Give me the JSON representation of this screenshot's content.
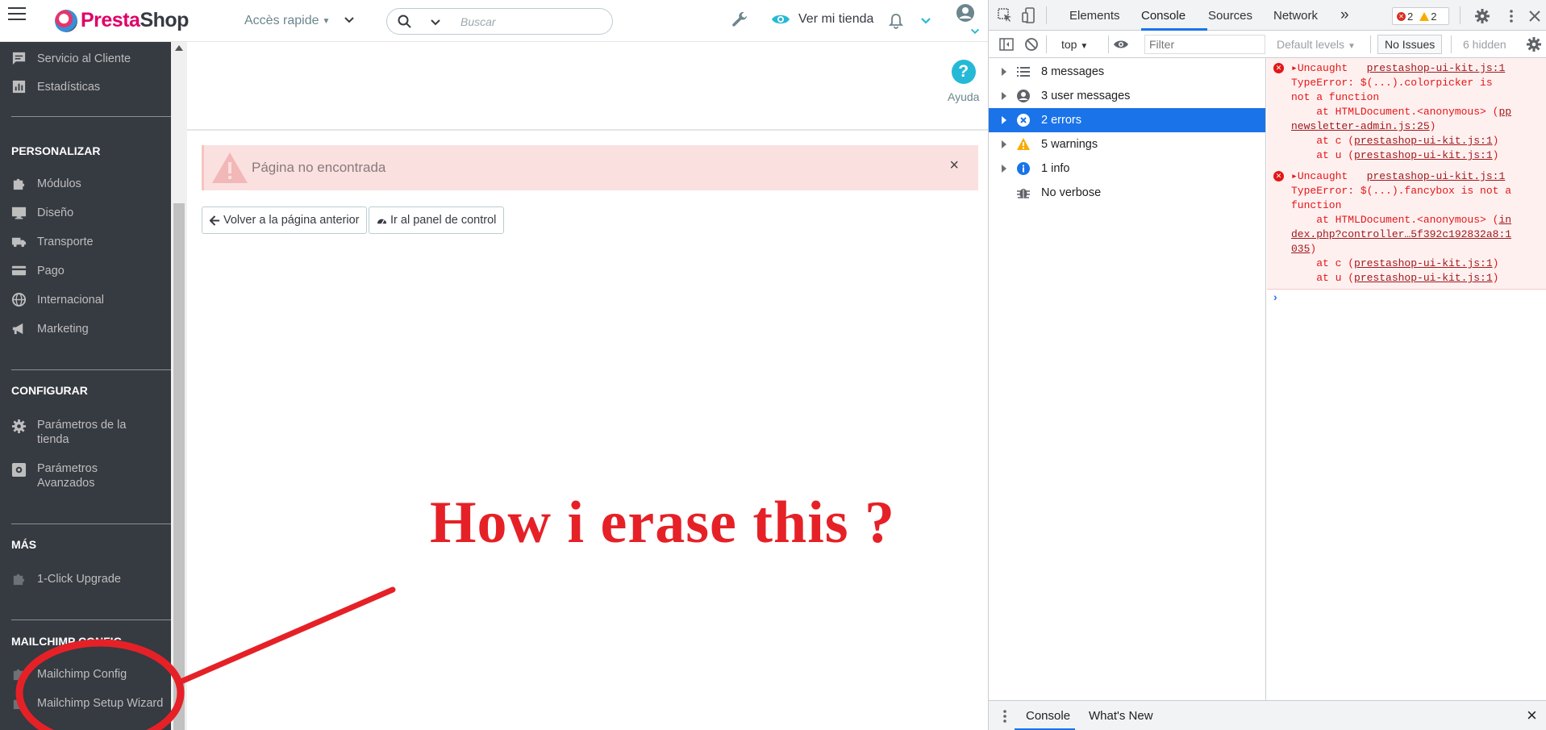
{
  "header": {
    "logo_presta": "Presta",
    "logo_shop": "Shop",
    "quick_access": "Accès rapide",
    "search_placeholder": "Buscar",
    "view_store": "Ver mi tienda",
    "accent": "#25b9d7"
  },
  "sidebar": {
    "items_top": [
      {
        "label": "Servicio al Cliente",
        "icon": "chat-icon"
      },
      {
        "label": "Estadísticas",
        "icon": "chart-icon"
      }
    ],
    "sections": [
      {
        "title": "PERSONALIZAR"
      },
      {
        "title": "CONFIGURAR"
      },
      {
        "title": "MÁS"
      },
      {
        "title": "MAILCHIMP CONFIG"
      }
    ],
    "personalizar": [
      "Módulos",
      "Diseño",
      "Transporte",
      "Pago",
      "Internacional",
      "Marketing"
    ],
    "configurar": [
      "Parámetros de la tienda",
      "Parámetros Avanzados"
    ],
    "mas": [
      "1-Click Upgrade"
    ],
    "mailchimp": [
      "Mailchimp Config",
      "Mailchimp Setup Wizard"
    ]
  },
  "main": {
    "help_label": "Ayuda",
    "alert_text": "Página no encontrada",
    "alert_close": "×",
    "back_button": "Volver a la página anterior",
    "dashboard_button": "Ir al panel de control"
  },
  "annotation": {
    "text": "How i erase this ?",
    "color": "#e52127"
  },
  "devtools": {
    "tabs": [
      "Elements",
      "Console",
      "Sources",
      "Network"
    ],
    "more": "»",
    "active_tab": "Console",
    "error_count": "2",
    "warning_count": "2",
    "context": "top",
    "filter_placeholder": "Filter",
    "levels": "Default levels",
    "no_issues": "No Issues",
    "hidden": "6 hidden",
    "sidebar": [
      {
        "label": "8 messages",
        "icon": "list-icon"
      },
      {
        "label": "3 user messages",
        "icon": "user-circle-icon"
      },
      {
        "label": "2 errors",
        "icon": "error-icon"
      },
      {
        "label": "5 warnings",
        "icon": "warning-icon"
      },
      {
        "label": "1 info",
        "icon": "info-icon"
      },
      {
        "label": "No verbose",
        "icon": "bug-icon"
      }
    ],
    "errors": [
      {
        "title": "Uncaught",
        "source": "prestashop-ui-kit.js:1",
        "lines": [
          "TypeError: $(...).colorpicker is",
          "not a function"
        ],
        "stack": [
          {
            "pre": "    at HTMLDocument.<anonymous> (",
            "link": "pp"
          },
          {
            "pre": "",
            "link": "newsletter-admin.js:25",
            "post": ")"
          },
          {
            "pre": "    at c (",
            "link": "prestashop-ui-kit.js:1",
            "post": ")"
          },
          {
            "pre": "    at u (",
            "link": "prestashop-ui-kit.js:1",
            "post": ")"
          }
        ]
      },
      {
        "title": "Uncaught",
        "source": "prestashop-ui-kit.js:1",
        "lines": [
          "TypeError: $(...).fancybox is not a",
          "function"
        ],
        "stack": [
          {
            "pre": "    at HTMLDocument.<anonymous> (",
            "link": "in"
          },
          {
            "pre": "",
            "link": "dex.php?controller…5f392c192832a8:1"
          },
          {
            "pre": "",
            "link": "035",
            "post": ")"
          },
          {
            "pre": "    at c (",
            "link": "prestashop-ui-kit.js:1",
            "post": ")"
          },
          {
            "pre": "    at u (",
            "link": "prestashop-ui-kit.js:1",
            "post": ")"
          }
        ]
      }
    ],
    "prompt": "›",
    "drawer_tabs": [
      "Console",
      "What's New"
    ],
    "close": "×"
  }
}
